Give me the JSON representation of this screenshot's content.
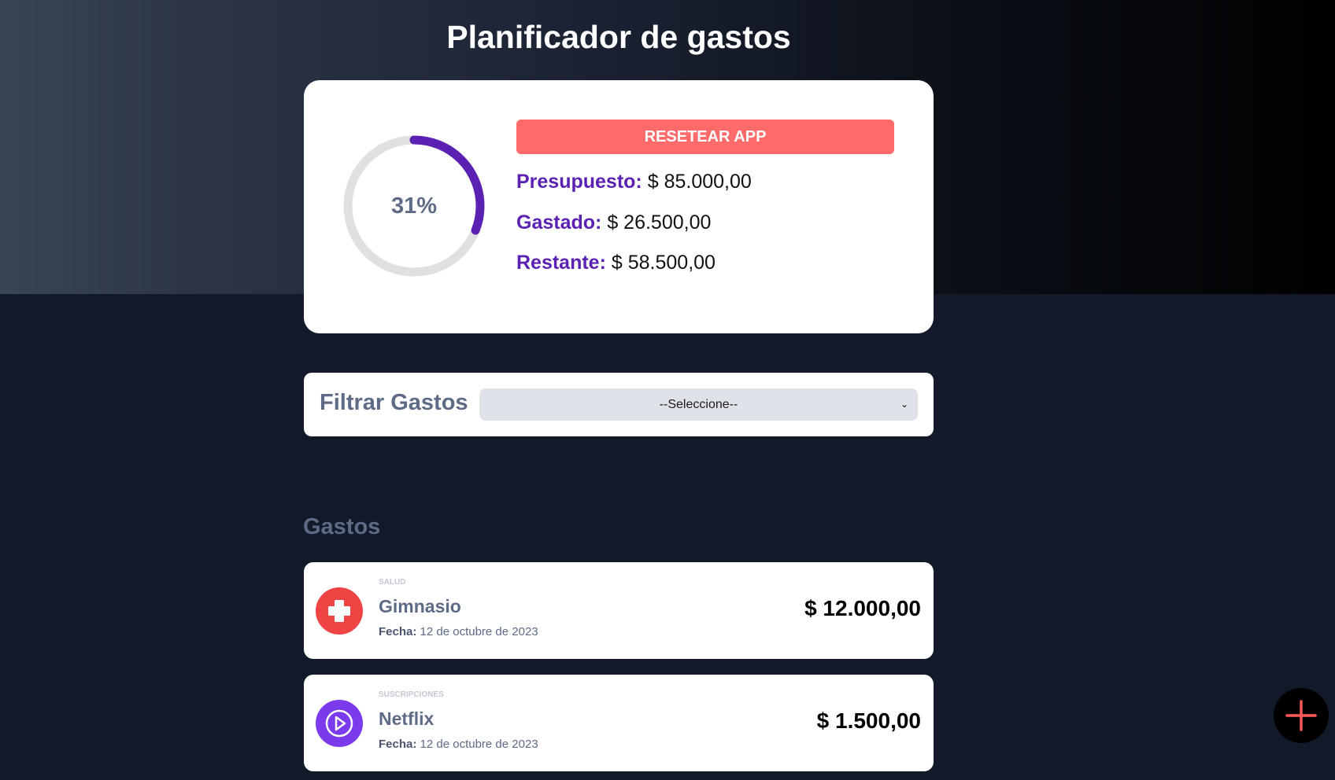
{
  "app": {
    "title": "Planificador de gastos"
  },
  "budget": {
    "percent": 31,
    "percent_label": "31%",
    "reset_label": "RESETEAR APP",
    "budget_label": "Presupuesto:",
    "budget_value": "$ 85.000,00",
    "spent_label": "Gastado:",
    "spent_value": "$ 26.500,00",
    "remaining_label": "Restante:",
    "remaining_value": "$ 58.500,00"
  },
  "filter": {
    "label": "Filtrar Gastos",
    "selected": "--Seleccione--"
  },
  "expenses": {
    "title": "Gastos",
    "items": [
      {
        "category": "Salud",
        "name": "Gimnasio",
        "date_label": "Fecha:",
        "date": "12 de octubre de 2023",
        "amount": "$ 12.000,00",
        "icon": "medical-cross-icon"
      },
      {
        "category": "Suscripciones",
        "name": "Netflix",
        "date_label": "Fecha:",
        "date": "12 de octubre de 2023",
        "amount": "$ 1.500,00",
        "icon": "play-icon"
      }
    ]
  },
  "fab": {
    "icon": "plus-icon"
  },
  "colors": {
    "accent": "#5a21b3",
    "progress_track": "#e0e0e0",
    "reset_button": "#ff6b6b",
    "salud_icon": "#ef4444",
    "suscripciones_icon": "#7c3aed",
    "fab_plus": "#ff5a5a"
  }
}
